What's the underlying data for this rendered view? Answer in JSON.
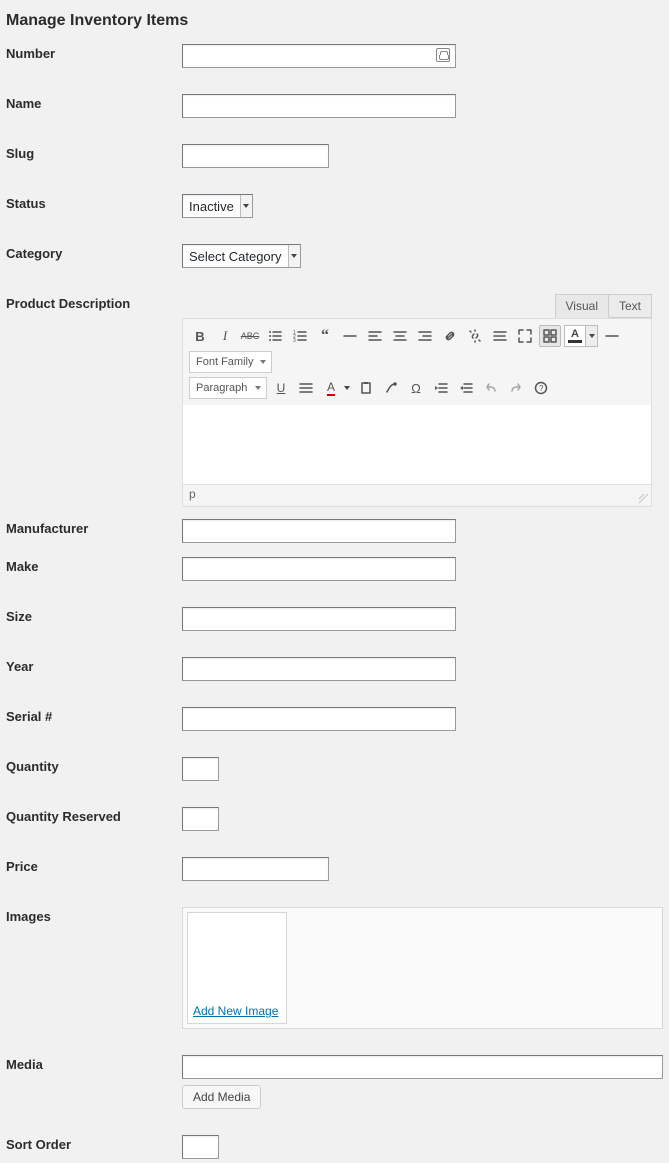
{
  "page_title": "Manage Inventory Items",
  "fields": {
    "number": {
      "label": "Number",
      "value": ""
    },
    "name": {
      "label": "Name",
      "value": ""
    },
    "slug": {
      "label": "Slug",
      "value": ""
    },
    "status": {
      "label": "Status",
      "selected": "Inactive"
    },
    "category": {
      "label": "Category",
      "selected": "Select Category"
    },
    "description": {
      "label": "Product Description"
    },
    "manufacturer": {
      "label": "Manufacturer",
      "value": ""
    },
    "make": {
      "label": "Make",
      "value": ""
    },
    "size": {
      "label": "Size",
      "value": ""
    },
    "year": {
      "label": "Year",
      "value": ""
    },
    "serial": {
      "label": "Serial #",
      "value": ""
    },
    "quantity": {
      "label": "Quantity",
      "value": ""
    },
    "qty_reserved": {
      "label": "Quantity Reserved",
      "value": ""
    },
    "price": {
      "label": "Price",
      "value": ""
    },
    "images": {
      "label": "Images",
      "add_new_label": "Add New Image"
    },
    "media": {
      "label": "Media",
      "value": "",
      "add_button": "Add Media"
    },
    "sort_order": {
      "label": "Sort Order",
      "value": ""
    }
  },
  "editor": {
    "tabs": {
      "visual": "Visual",
      "text": "Text"
    },
    "font_family_label": "Font Family",
    "paragraph_label": "Paragraph",
    "status_path": "p"
  }
}
